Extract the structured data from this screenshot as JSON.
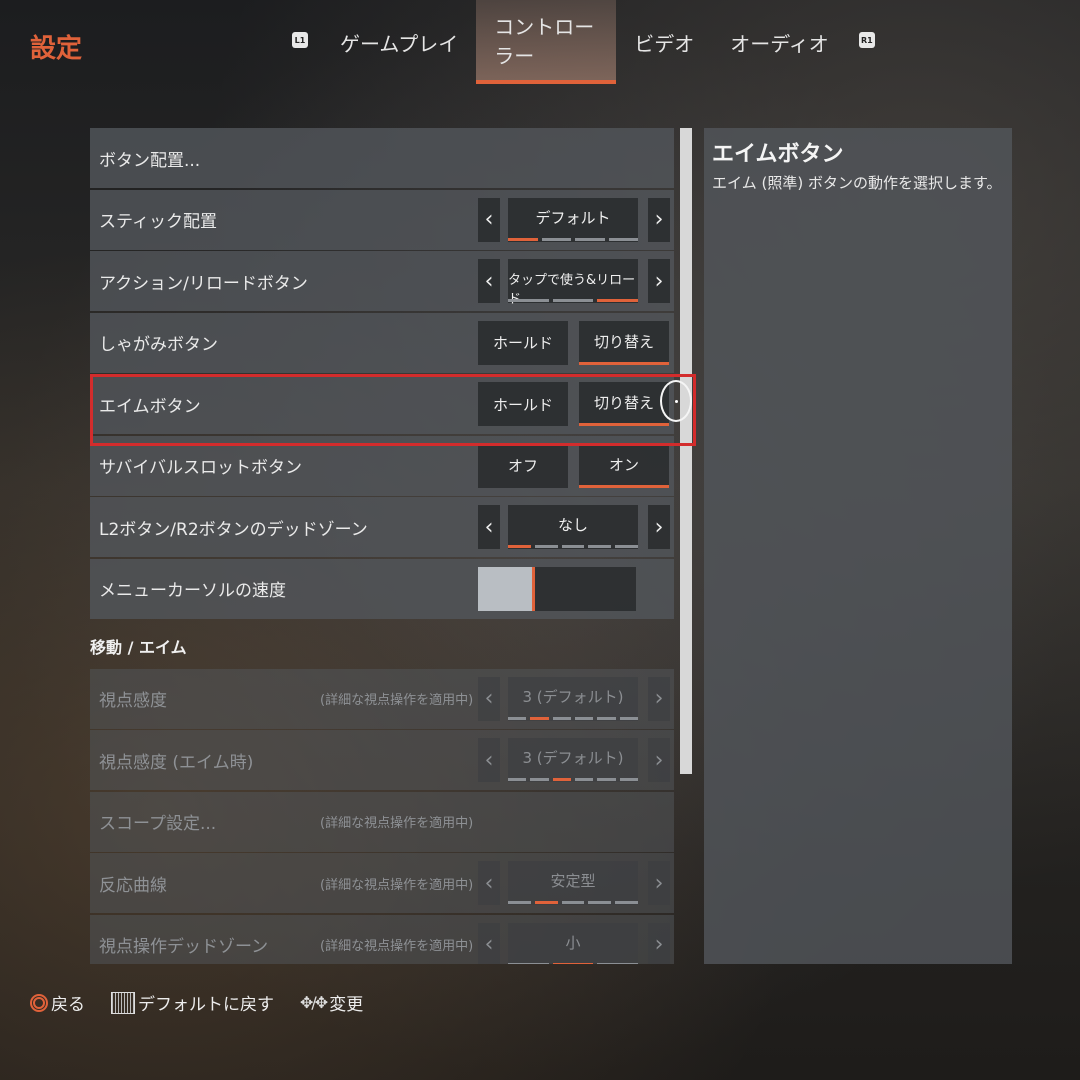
{
  "header": {
    "title": "設定",
    "l1": "L1",
    "r1": "R1",
    "tabs": [
      {
        "label": "ゲームプレイ"
      },
      {
        "label": "コントローラー"
      },
      {
        "label": "ビデオ"
      },
      {
        "label": "オーディオ"
      }
    ],
    "active_tab": "コントローラー"
  },
  "settings": {
    "rows": [
      {
        "label": "ボタン配置..."
      },
      {
        "label": "スティック配置",
        "value": "デフォルト",
        "dots": 4,
        "active_dot": 0
      },
      {
        "label": "アクション/リロードボタン",
        "value": "タップで使う&リロード",
        "dots": 3,
        "active_dot": 2
      },
      {
        "label": "しゃがみボタン",
        "opt1": "ホールド",
        "opt2": "切り替え",
        "selected": "切り替え"
      },
      {
        "label": "エイムボタン",
        "opt1": "ホールド",
        "opt2": "切り替え",
        "selected": "切り替え"
      },
      {
        "label": "サバイバルスロットボタン",
        "opt1": "オフ",
        "opt2": "オン",
        "selected": "オン"
      },
      {
        "label": "L2ボタン/R2ボタンのデッドゾーン",
        "value": "なし",
        "dots": 5,
        "active_dot": 0
      },
      {
        "label": "メニューカーソルの速度",
        "slider_level": 0.36
      }
    ],
    "section": "移動 / エイム",
    "aim_rows": [
      {
        "label": "視点感度",
        "note": "(詳細な視点操作を適用中)",
        "value": "3 (デフォルト)",
        "dots": 6,
        "active_dot": 1
      },
      {
        "label": "視点感度 (エイム時)",
        "value": "3 (デフォルト)",
        "dots": 6,
        "active_dot": 2
      },
      {
        "label": "スコープ設定...",
        "note": "(詳細な視点操作を適用中)"
      },
      {
        "label": "反応曲線",
        "note": "(詳細な視点操作を適用中)",
        "value": "安定型",
        "dots": 5,
        "active_dot": 1
      },
      {
        "label": "視点操作デッドゾーン",
        "note": "(詳細な視点操作を適用中)",
        "value": "小",
        "dots": 3,
        "active_dot": 1
      }
    ]
  },
  "info": {
    "title": "エイムボタン",
    "description": "エイム (照準) ボタンの動作を選択します。"
  },
  "footer": {
    "back": "戻る",
    "reset": "デフォルトに戻す",
    "change": "変更"
  },
  "colors": {
    "accent": "#e0623a",
    "highlight": "#d32c2c",
    "panel": "#52565a"
  }
}
